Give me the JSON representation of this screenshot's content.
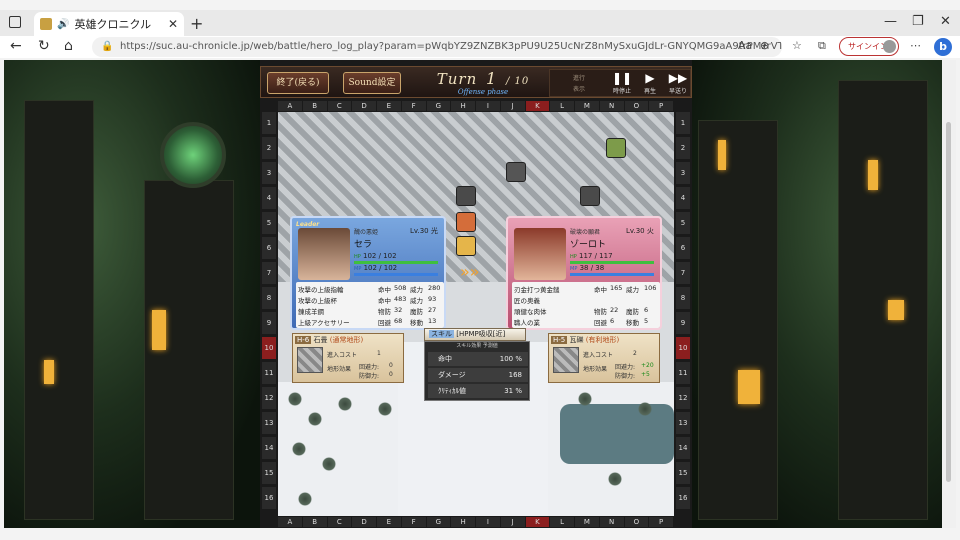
{
  "browser": {
    "tab_title": "英雄クロニクル",
    "close_glyph": "✕",
    "new_tab_glyph": "+",
    "url": "https://suc.au-chronicle.jp/web/battle/hero_log_play?param=pWqbYZ9ZNZBK3pPU9U25UcNrZ8nMySxuGJdLr-GNYQMG9aA9trPMzrVTOV7Bi_wdryavxxEbT...",
    "signin_label": "サインイン",
    "win_minimize": "—",
    "win_restore": "❐",
    "win_close": "✕",
    "bing_label": "b"
  },
  "game": {
    "end_button": "終了(戻る)",
    "sound_button": "Sound設定",
    "turn_label": "Turn",
    "turn_current": "1",
    "turn_total": "/ 10",
    "phase": "Offense phase",
    "dim_text1": "進行",
    "dim_text2": "表示",
    "pause_label": "時停止",
    "play_label": "再生",
    "ff_label": "早送り",
    "pause_glyph": "❚❚",
    "play_glyph": "▶",
    "ff_glyph": "▶▶",
    "columns": [
      "A",
      "B",
      "C",
      "D",
      "E",
      "F",
      "G",
      "H",
      "I",
      "J",
      "K",
      "L",
      "M",
      "N",
      "O",
      "P"
    ],
    "rows": [
      "1",
      "2",
      "3",
      "4",
      "5",
      "6",
      "7",
      "8",
      "9",
      "10",
      "11",
      "12",
      "13",
      "14",
      "15",
      "16"
    ],
    "active_column": "K",
    "active_row": "10"
  },
  "left_unit": {
    "leader": "Leader",
    "subtitle": "醜の悪姫",
    "level": "Lv.30 光",
    "name": "セラ",
    "hp_label": "HP",
    "hp": "102 / 102",
    "mp_label": "MP",
    "mp": "102 / 102",
    "equip": [
      {
        "name": "攻撃の上級指輪",
        "stat1_label": "命中",
        "stat1_value": "508",
        "stat2_label": "威力",
        "stat2_value": "280"
      },
      {
        "name": "攻撃の上級杯",
        "stat1_label": "命中",
        "stat1_value": "483",
        "stat2_label": "威力",
        "stat2_value": "93"
      },
      {
        "name": "錬成羊鋼",
        "stat1_label": "物防",
        "stat1_value": "32",
        "stat2_label": "魔防",
        "stat2_value": "27"
      },
      {
        "name": "上級アクセサリー",
        "stat1_label": "回避",
        "stat1_value": "68",
        "stat2_label": "移動",
        "stat2_value": "13"
      }
    ]
  },
  "right_unit": {
    "subtitle": "破壊の願君",
    "level": "Lv.30 火",
    "name": "ゾーロト",
    "hp_label": "HP",
    "hp": "117 / 117",
    "mp_label": "MP",
    "mp": "38 / 38",
    "equip": [
      {
        "name": "刃金打つ黄金鎚",
        "stat1_label": "命中",
        "stat1_value": "165",
        "stat2_label": "威力",
        "stat2_value": "106"
      },
      {
        "name": "匠の奥義",
        "stat1_label": "",
        "stat1_value": "",
        "stat2_label": "",
        "stat2_value": ""
      },
      {
        "name": "頑健な肉体",
        "stat1_label": "物防",
        "stat1_value": "22",
        "stat2_label": "魔防",
        "stat2_value": "6"
      },
      {
        "name": "職人の業",
        "stat1_label": "回避",
        "stat1_value": "6",
        "stat2_label": "移動",
        "stat2_value": "5"
      }
    ]
  },
  "skill": {
    "label": "スキル",
    "name": "[HPMP吸収[近]"
  },
  "forecast": {
    "header": "スキル効果   予測値",
    "rows": [
      {
        "label": "命中",
        "value": "100 %"
      },
      {
        "label": "ダメージ",
        "value": "168"
      },
      {
        "label": "ｸﾘﾃｨｶﾙ値",
        "value": "31 %"
      }
    ]
  },
  "terrain_left": {
    "coord": "H-6",
    "name": "石畳",
    "type": "(通常地形)",
    "cost_label": "進入コスト",
    "cost": "1",
    "effect_label": "地形効果",
    "eva_label": "回避力:",
    "eva": "0",
    "def_label": "防御力:",
    "def": "0"
  },
  "terrain_right": {
    "coord": "H-5",
    "name": "瓦礫",
    "type": "(有利地形)",
    "cost_label": "進入コスト",
    "cost": "2",
    "effect_label": "地形効果",
    "eva_label": "回避力:",
    "eva": "+20",
    "def_label": "防御力:",
    "def": "+5"
  },
  "colors": {
    "left_card": "#3d69b5",
    "right_card": "#b84f70",
    "active_marker": "#8b1e1e",
    "bonus_green": "#1a8a1a"
  }
}
